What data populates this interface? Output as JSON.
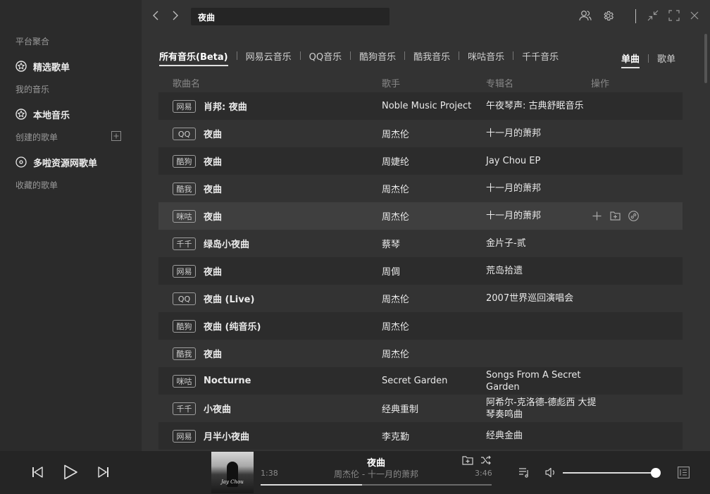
{
  "sidebar": {
    "section_platform": "平台聚合",
    "featured_playlists": "精选歌单",
    "section_my_music": "我的音乐",
    "local_music": "本地音乐",
    "section_created": "创建的歌单",
    "multi_source": "多啦资源网歌单",
    "section_collected": "收藏的歌单"
  },
  "search": {
    "value": "夜曲"
  },
  "tabs": [
    "所有音乐(Beta)",
    "网易云音乐",
    "QQ音乐",
    "酷狗音乐",
    "酷我音乐",
    "咪咕音乐",
    "千千音乐"
  ],
  "type_tabs": [
    "单曲",
    "歌单"
  ],
  "columns": {
    "title": "歌曲名",
    "artist": "歌手",
    "album": "专辑名",
    "actions": "操作"
  },
  "rows": [
    {
      "source": "网易",
      "title": "肖邦: 夜曲",
      "artist": "Noble Music Project",
      "album": "午夜琴声: 古典舒眠音乐"
    },
    {
      "source": "QQ",
      "title": "夜曲",
      "artist": "周杰伦",
      "album": "十一月的萧邦"
    },
    {
      "source": "酷狗",
      "title": "夜曲",
      "artist": "周婕纶",
      "album": "Jay Chou EP"
    },
    {
      "source": "酷我",
      "title": "夜曲",
      "artist": "周杰伦",
      "album": "十一月的萧邦"
    },
    {
      "source": "咪咕",
      "title": "夜曲",
      "artist": "周杰伦",
      "album": "十一月的萧邦"
    },
    {
      "source": "千千",
      "title": "绿岛小夜曲",
      "artist": "蔡琴",
      "album": "金片子-贰"
    },
    {
      "source": "网易",
      "title": "夜曲",
      "artist": "周倜",
      "album": "荒岛拾遗"
    },
    {
      "source": "QQ",
      "title": "夜曲 (Live)",
      "artist": "周杰伦",
      "album": "2007世界巡回演唱会"
    },
    {
      "source": "酷狗",
      "title": "夜曲 (纯音乐)",
      "artist": "周杰伦",
      "album": ""
    },
    {
      "source": "酷我",
      "title": "夜曲",
      "artist": "周杰伦",
      "album": ""
    },
    {
      "source": "咪咕",
      "title": "Nocturne",
      "artist": "Secret Garden",
      "album": "Songs From A Secret Garden"
    },
    {
      "source": "千千",
      "title": "小夜曲",
      "artist": "经典重制",
      "album": "阿希尔-克洛德-德彪西 大提琴奏鸣曲"
    },
    {
      "source": "网易",
      "title": "月半小夜曲",
      "artist": "李克勤",
      "album": "经典金曲"
    }
  ],
  "player": {
    "title": "夜曲",
    "subtitle": "周杰伦 - 十一月的萧邦",
    "current_time": "1:38",
    "total_time": "3:46",
    "progress": 0.44,
    "volume": 1.0,
    "cover_text": "Jay Chou"
  }
}
